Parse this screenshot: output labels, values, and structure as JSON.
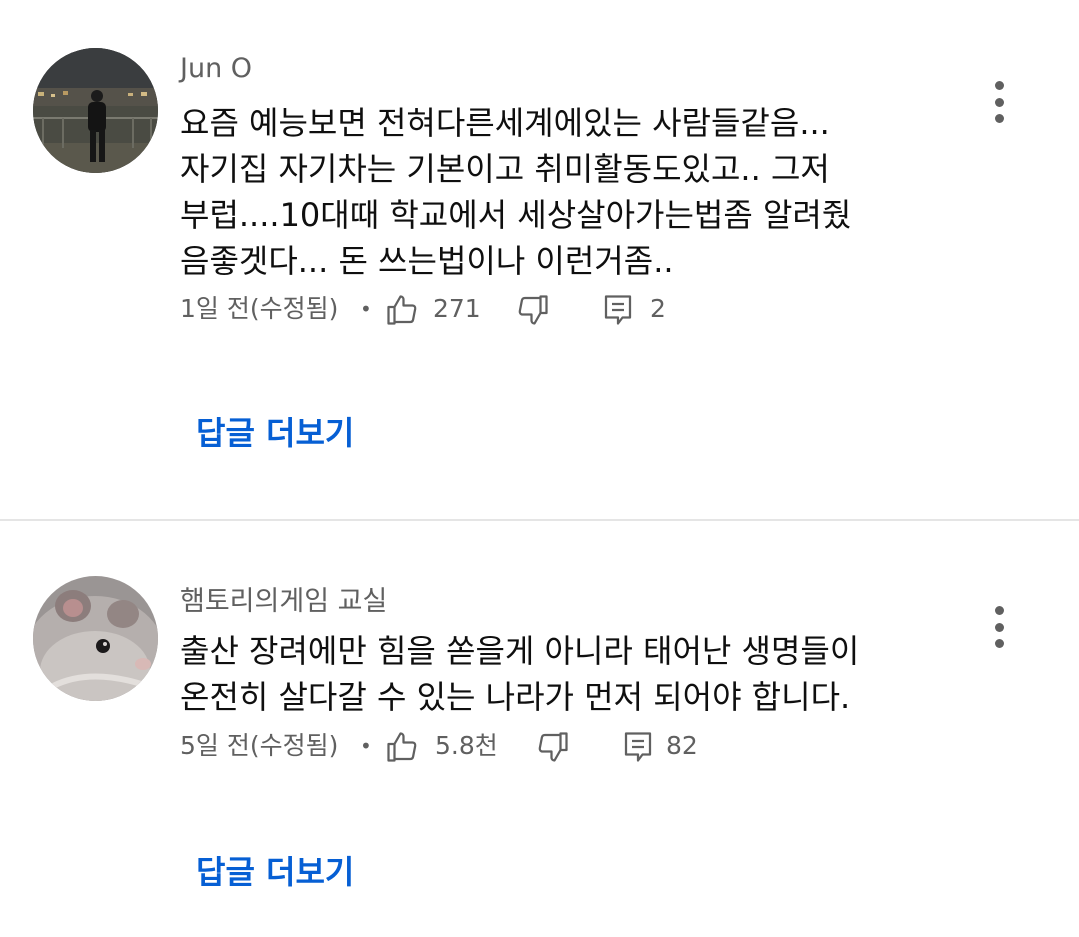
{
  "comments": [
    {
      "author": "Jun O",
      "lines": [
        "요즘 예능보면 전혀다른세계에있는 사람들같음...",
        "자기집 자기차는 기본이고 취미활동도있고.. 그저",
        "부럽....10대때 학교에서 세상살아가는법좀 알려줬",
        "음좋겟다... 돈 쓰는법이나 이런거좀.."
      ],
      "time": "1일 전(수정됨)",
      "separator": "•",
      "likes": "271",
      "replies": "2",
      "more_replies_label": "답글 더보기",
      "avatar_icon": "person-night-city-photo"
    },
    {
      "author": "햄토리의게임 교실",
      "lines": [
        "출산 장려에만 힘을 쏟을게 아니라 태어난 생명들이",
        "온전히 살다갈 수 있는 나라가 먼저 되어야 합니다."
      ],
      "time": "5일 전(수정됨)",
      "separator": "•",
      "likes": "5.8천",
      "replies": "82",
      "more_replies_label": "답글 더보기",
      "avatar_icon": "hamster-photo"
    }
  ],
  "icons": {
    "like": "thumbs-up-icon",
    "dislike": "thumbs-down-icon",
    "reply": "reply-comment-icon",
    "menu": "more-vertical-icon"
  },
  "colors": {
    "link": "#065fd4",
    "secondary_text": "#606060",
    "primary_text": "#0f0f0f",
    "divider": "#e5e5e5"
  }
}
